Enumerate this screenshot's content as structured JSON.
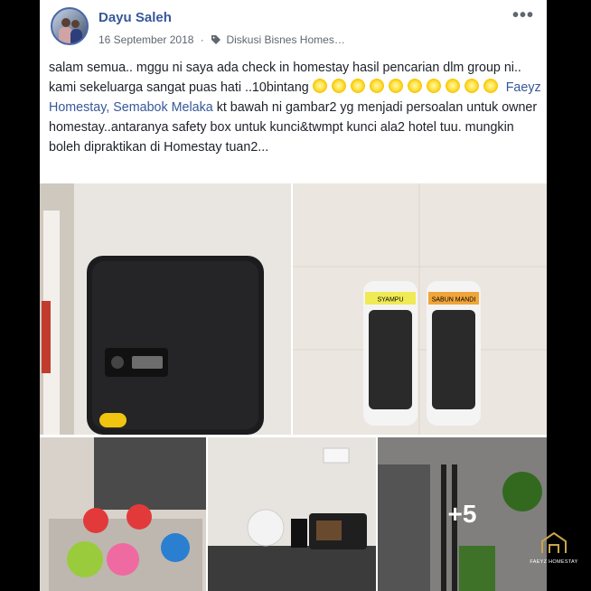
{
  "post": {
    "author": "Dayu Saleh",
    "date": "16 September 2018",
    "separator": "·",
    "group": "Diskusi Bisnes Homes…",
    "text_before_link": "salam semua.. mggu ni saya ada check in homestay hasil pencarian dlm group ni.. kami sekeluarga sangat puas hati ..10bintang",
    "link_text": "Faeyz Homestay, Semabok Melaka",
    "text_after_link": "kt bawah ni gambar2 yg menjadi persoalan untuk owner homestay..antaranya safety box untuk kunci&twmpt kunci ala2 hotel tuu. mungkin boleh dipraktikan di Homestay tuan2..."
  },
  "photos": {
    "shampoo_label": "SYAMPU",
    "soap_label": "SABUN MANDI",
    "more_count": "+5"
  },
  "watermark": {
    "text": "FAEYZ HOMESTAY"
  },
  "icons": {
    "more": "more-horizontal-icon",
    "group": "tag-icon",
    "star": "glowing-star-emoji",
    "logo": "house-logo-icon"
  },
  "colors": {
    "author": "#365899",
    "link": "#365899",
    "meta": "#606770",
    "text": "#1d2129"
  }
}
